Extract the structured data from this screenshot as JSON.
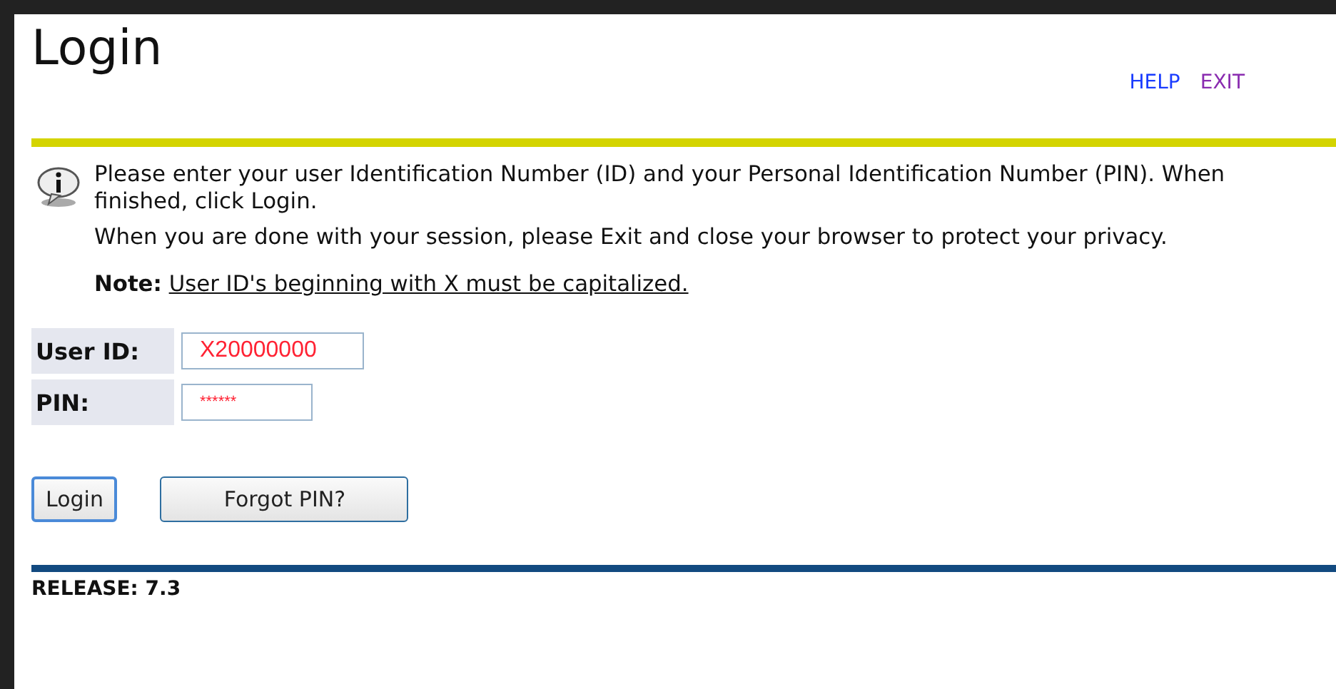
{
  "title": "Login",
  "links": [
    "HELP",
    "EXIT"
  ],
  "info": [
    "Please enter your user Identification Number (ID) and your Personal Identification Number (PIN). When finished, click Login.",
    "When you are done with your session, please Exit and close your browser to protect your privacy."
  ],
  "note": {
    "label": "Note:",
    "text": "User ID's beginning with X must be capitalized."
  },
  "fields": [
    {
      "label": "User ID:",
      "value": "X20000000",
      "kind": "text"
    },
    {
      "label": "PIN:",
      "value": "******",
      "kind": "password"
    }
  ],
  "buttons": [
    "Login",
    "Forgot PIN?"
  ],
  "release": "RELEASE: 7.3"
}
